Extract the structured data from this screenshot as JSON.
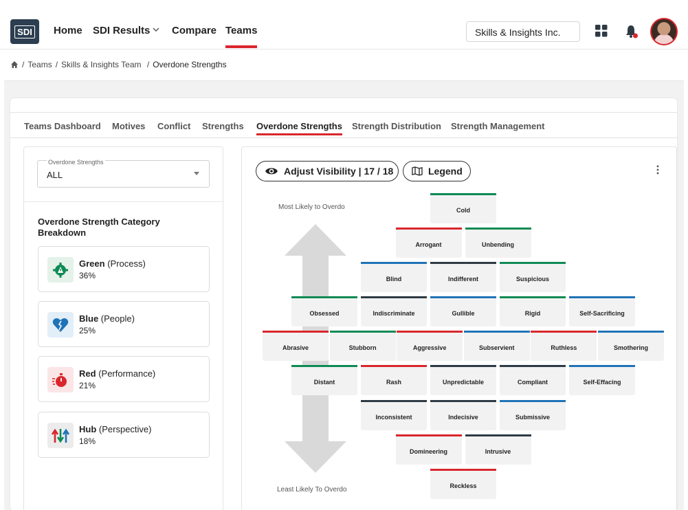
{
  "nav": {
    "logo_text": "SDI",
    "items": [
      "Home",
      "SDI Results",
      "Compare",
      "Teams"
    ],
    "active": "Teams",
    "company": "Skills & Insights Inc."
  },
  "breadcrumb": [
    "Teams",
    "Skills & Insights Team",
    "Overdone Strengths"
  ],
  "tabs": [
    "Teams Dashboard",
    "Motives",
    "Conflict",
    "Strengths",
    "Overdone Strengths",
    "Strength Distribution",
    "Strength Management"
  ],
  "active_tab": "Overdone Strengths",
  "filter": {
    "label": "Overdone Strengths",
    "value": "ALL"
  },
  "breakdown": {
    "title": "Overdone Strength Category Breakdown",
    "categories": [
      {
        "name": "Green",
        "sub": "(Process)",
        "pct": "36%",
        "color": "#0e8a54",
        "bg": "#e4f2ea"
      },
      {
        "name": "Blue",
        "sub": "(People)",
        "pct": "25%",
        "color": "#1f73b7",
        "bg": "#e2eef8"
      },
      {
        "name": "Red",
        "sub": "(Performance)",
        "pct": "21%",
        "color": "#d9262c",
        "bg": "#fbe5e6"
      },
      {
        "name": "Hub",
        "sub": "(Perspective)",
        "pct": "18%",
        "color": "#555555",
        "bg": "#ececec"
      }
    ]
  },
  "controls": {
    "visibility": "Adjust Visibility | 17 / 18",
    "legend": "Legend"
  },
  "axis": {
    "top": "Most Likely to Overdo",
    "bottom": "Least Likely To Overdo"
  },
  "colors": {
    "green": "#0e8a54",
    "blue": "#1f73b7",
    "red": "#d9262c",
    "hub": "#2e3a44",
    "accent": "#d9262c"
  },
  "pyramid": [
    [
      {
        "label": "Cold",
        "color": "green"
      }
    ],
    [
      {
        "label": "Arrogant",
        "color": "red"
      },
      {
        "label": "Unbending",
        "color": "green"
      }
    ],
    [
      {
        "label": "Blind",
        "color": "blue"
      },
      {
        "label": "Indifferent",
        "color": "hub"
      },
      {
        "label": "Suspicious",
        "color": "green"
      }
    ],
    [
      {
        "label": "Obsessed",
        "color": "green"
      },
      {
        "label": "Indiscriminate",
        "color": "hub"
      },
      {
        "label": "Gullible",
        "color": "blue"
      },
      {
        "label": "Rigid",
        "color": "green"
      },
      {
        "label": "Self-Sacrificing",
        "color": "blue"
      }
    ],
    [
      {
        "label": "Abrasive",
        "color": "red"
      },
      {
        "label": "Stubborn",
        "color": "green"
      },
      {
        "label": "Aggressive",
        "color": "red"
      },
      {
        "label": "Subservient",
        "color": "blue"
      },
      {
        "label": "Ruthless",
        "color": "red"
      },
      {
        "label": "Smothering",
        "color": "blue"
      }
    ],
    [
      {
        "label": "Distant",
        "color": "green"
      },
      {
        "label": "Rash",
        "color": "red"
      },
      {
        "label": "Unpredictable",
        "color": "hub"
      },
      {
        "label": "Compliant",
        "color": "hub"
      },
      {
        "label": "Self-Effacing",
        "color": "blue"
      }
    ],
    [
      {
        "label": "Inconsistent",
        "color": "hub"
      },
      {
        "label": "Indecisive",
        "color": "hub"
      },
      {
        "label": "Submissive",
        "color": "blue"
      }
    ],
    [
      {
        "label": "Domineering",
        "color": "red"
      },
      {
        "label": "Intrusive",
        "color": "hub"
      }
    ],
    [
      {
        "label": "Reckless",
        "color": "red"
      }
    ]
  ]
}
